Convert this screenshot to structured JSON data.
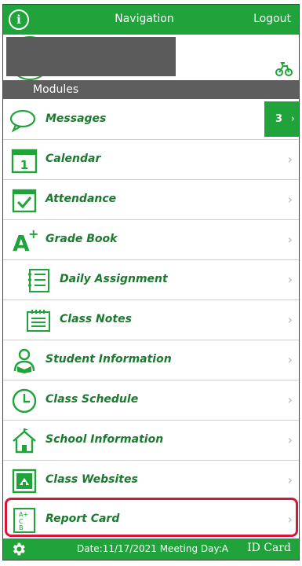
{
  "topbar": {
    "info_icon": "info-icon",
    "title": "Navigation",
    "logout": "Logout"
  },
  "profile": {
    "avatar": "avatar",
    "action_icon": "bike-icon"
  },
  "modules_header": "Modules",
  "items": [
    {
      "label": "Messages",
      "icon": "speech-bubble-icon",
      "badge": "3"
    },
    {
      "label": "Calendar",
      "icon": "calendar-icon"
    },
    {
      "label": "Attendance",
      "icon": "checkbox-calendar-icon"
    },
    {
      "label": "Grade Book",
      "icon": "a-plus-icon"
    },
    {
      "label": "Daily Assignment",
      "icon": "checklist-icon"
    },
    {
      "label": "Class Notes",
      "icon": "notepad-icon"
    },
    {
      "label": "Student Information",
      "icon": "student-reading-icon"
    },
    {
      "label": "Class Schedule",
      "icon": "clock-icon"
    },
    {
      "label": "School Information",
      "icon": "school-house-icon"
    },
    {
      "label": "Class Websites",
      "icon": "website-icon"
    },
    {
      "label": "Report Card",
      "icon": "report-card-icon"
    }
  ],
  "bottombar": {
    "settings_icon": "gear-icon",
    "date_text": "Date:11/17/2021 Meeting Day:A",
    "id_card": "ID Card"
  },
  "colors": {
    "brand_green": "#1fa33a",
    "text_green": "#1b7a2f",
    "header_gray": "#5e5e5e",
    "highlight_red": "#d4183d"
  }
}
